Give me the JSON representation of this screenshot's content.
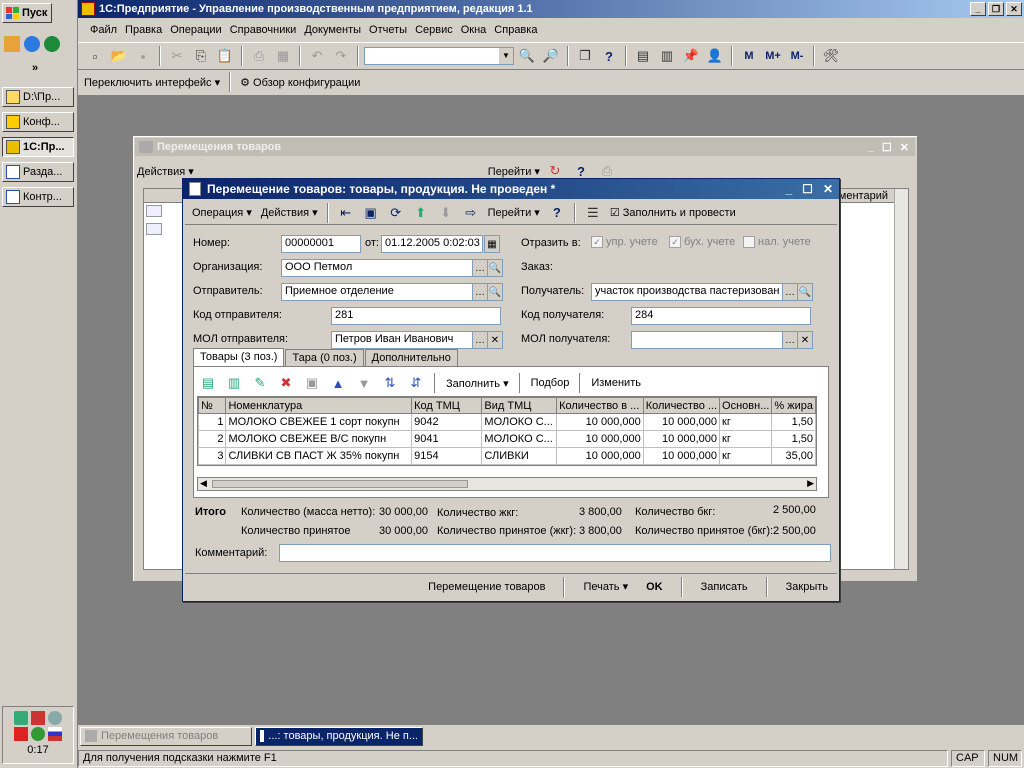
{
  "taskbar": {
    "start_label": "Пуск",
    "more_label": "»",
    "items": [
      {
        "label": "D:\\Пр..."
      },
      {
        "label": "Конф..."
      },
      {
        "label": "1С:Пр..."
      },
      {
        "label": "Разда..."
      },
      {
        "label": "Контр..."
      }
    ],
    "clock": "0:17"
  },
  "app": {
    "title": "1С:Предприятие - Управление производственным предприятием, редакция 1.1",
    "menu": [
      "Файл",
      "Правка",
      "Операции",
      "Справочники",
      "Документы",
      "Отчеты",
      "Сервис",
      "Окна",
      "Справка"
    ],
    "toolbar2": {
      "switch_interface": "Переключить интерфейс",
      "config_review": "Обзор конфигурации"
    },
    "toolbar_labels": {
      "m": "M",
      "mplus": "M+",
      "mminus": "M-"
    }
  },
  "bg_window": {
    "title": "Перемещения товаров",
    "actions": "Действия",
    "goto": "Перейти",
    "col_comment": "ментарий"
  },
  "doc_window": {
    "title": "Перемещение товаров: товары, продукция. Не проведен *",
    "toolbar": {
      "operation": "Операция",
      "actions": "Действия",
      "goto": "Перейти",
      "fill_post": "Заполнить и провести"
    },
    "fields": {
      "number_label": "Номер:",
      "number": "00000001",
      "from_label": "от:",
      "date": "01.12.2005  0:02:03",
      "reflect_label": "Отразить в:",
      "check_upr": "упр. учете",
      "check_buh": "бух. учете",
      "check_nal": "нал. учете",
      "org_label": "Организация:",
      "org": "ООО Петмол",
      "order_label": "Заказ:",
      "sender_label": "Отправитель:",
      "sender": "Приемное отделение",
      "receiver_label": "Получатель:",
      "receiver": "участок производства пастеризован",
      "sender_code_label": "Код отправителя:",
      "sender_code": "281",
      "receiver_code_label": "Код получателя:",
      "receiver_code": "284",
      "sender_mol_label": "МОЛ отправителя:",
      "sender_mol": "Петров Иван Иванович",
      "receiver_mol_label": "МОЛ получателя:",
      "receiver_mol": ""
    },
    "tabs": [
      "Товары (3 поз.)",
      "Тара (0 поз.)",
      "Дополнительно"
    ],
    "table_toolbar": {
      "fill": "Заполнить",
      "pick": "Подбор",
      "change": "Изменить"
    },
    "table": {
      "headers": [
        "№",
        "Номенклатура",
        "Код ТМЦ",
        "Вид ТМЦ",
        "Количество в ...",
        "Количество ...",
        "Основн...",
        "% жира"
      ],
      "rows": [
        [
          "1",
          "МОЛОКО СВЕЖЕЕ 1 сорт покупн",
          "9042",
          "МОЛОКО С...",
          "10 000,000",
          "10 000,000",
          "кг",
          "1,50"
        ],
        [
          "2",
          "МОЛОКО СВЕЖЕЕ В/С покупн",
          "9041",
          "МОЛОКО С...",
          "10 000,000",
          "10 000,000",
          "кг",
          "1,50"
        ],
        [
          "3",
          "СЛИВКИ СВ ПАСТ Ж 35%  покупн",
          "9154",
          "СЛИВКИ",
          "10 000,000",
          "10 000,000",
          "кг",
          "35,00"
        ]
      ]
    },
    "totals": {
      "title": "Итого",
      "qty_net_label": "Количество (масса нетто):",
      "qty_net": "30 000,00",
      "qty_zhkg_label": "Количество жкг:",
      "qty_zhkg": "3 800,00",
      "qty_bkg_label": "Количество бкг:",
      "qty_bkg": "2 500,00",
      "accepted_label": "Количество принятое",
      "accepted": "30 000,00",
      "accepted_zhkg_label": "Количество принятое (жкг):",
      "accepted_zhkg": "3 800,00",
      "accepted_bkg_label": "Количество принятое (бкг):",
      "accepted_bkg": "2 500,00"
    },
    "comment_label": "Комментарий:",
    "comment": "",
    "bottom": {
      "movement": "Перемещение товаров",
      "print": "Печать",
      "ok": "OK",
      "save": "Записать",
      "close": "Закрыть"
    }
  },
  "window_bar": [
    "Перемещения товаров",
    "...: товары, продукция. Не п..."
  ],
  "status": {
    "hint": "Для получения подсказки нажмите F1",
    "cap": "CAP",
    "num": "NUM"
  }
}
